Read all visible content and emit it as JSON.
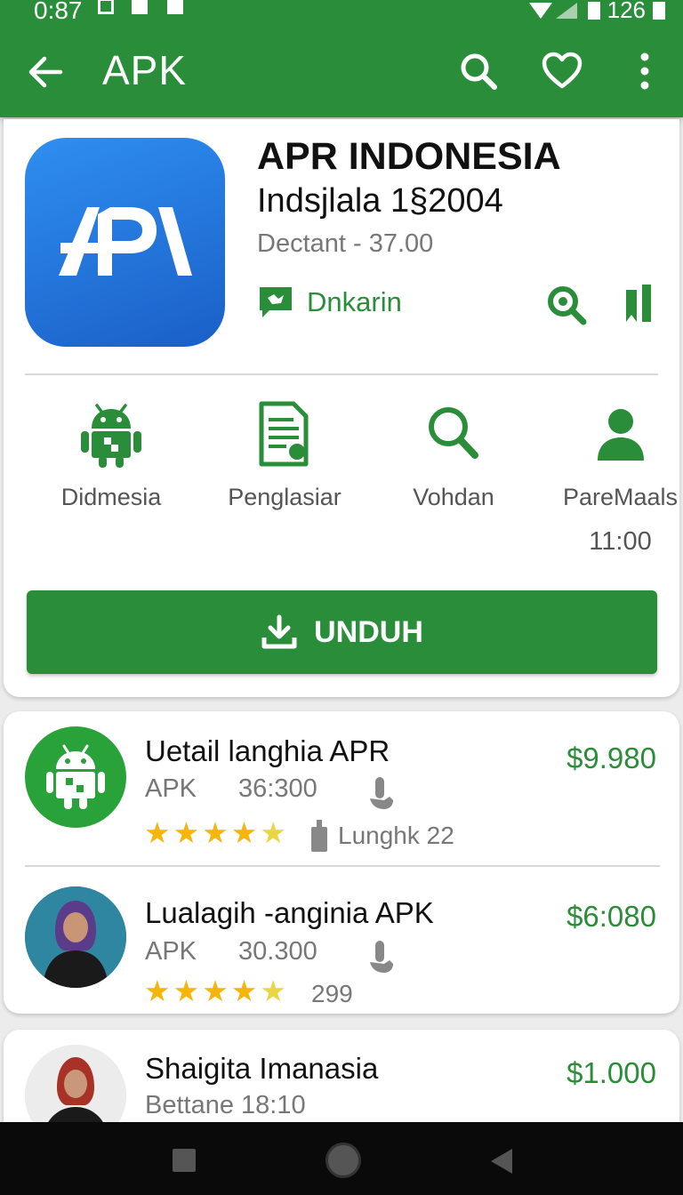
{
  "status_bar": {
    "time": "0:87",
    "battery": "126"
  },
  "toolbar": {
    "title": "APK"
  },
  "app": {
    "icon_text": "APA",
    "name": "APR INDONESIA",
    "subtitle": "Indsjlala 1§2004",
    "meta": "Dectant - 37.00",
    "developer_link": "Dnkarin"
  },
  "features": [
    {
      "label": "Didmesia",
      "icon": "android-icon"
    },
    {
      "label": "Penglasiar",
      "icon": "document-icon"
    },
    {
      "label": "Vohdan",
      "icon": "search-icon"
    },
    {
      "label": "PareMaals",
      "extra": "11:00",
      "icon": "person-icon"
    }
  ],
  "download": {
    "label": "UNDUH"
  },
  "list": [
    {
      "title": "Uetail langhia APR",
      "type": "APK",
      "count": "36:300",
      "price": "$9.980",
      "rating": 4.5,
      "rating_text": "Lunghk 22"
    },
    {
      "title": "Lualagih -anginia APK",
      "type": "APK",
      "count": "30.300",
      "price": "$6:080",
      "rating": 4.5,
      "rating_text": "299"
    },
    {
      "title": "Shaigita Imanasia",
      "meta": "Bettane 18:10",
      "price": "$1.000"
    }
  ],
  "colors": {
    "primary": "#2a8d3a",
    "star": "#f5b50a",
    "app_icon": "#1f6fd8"
  }
}
